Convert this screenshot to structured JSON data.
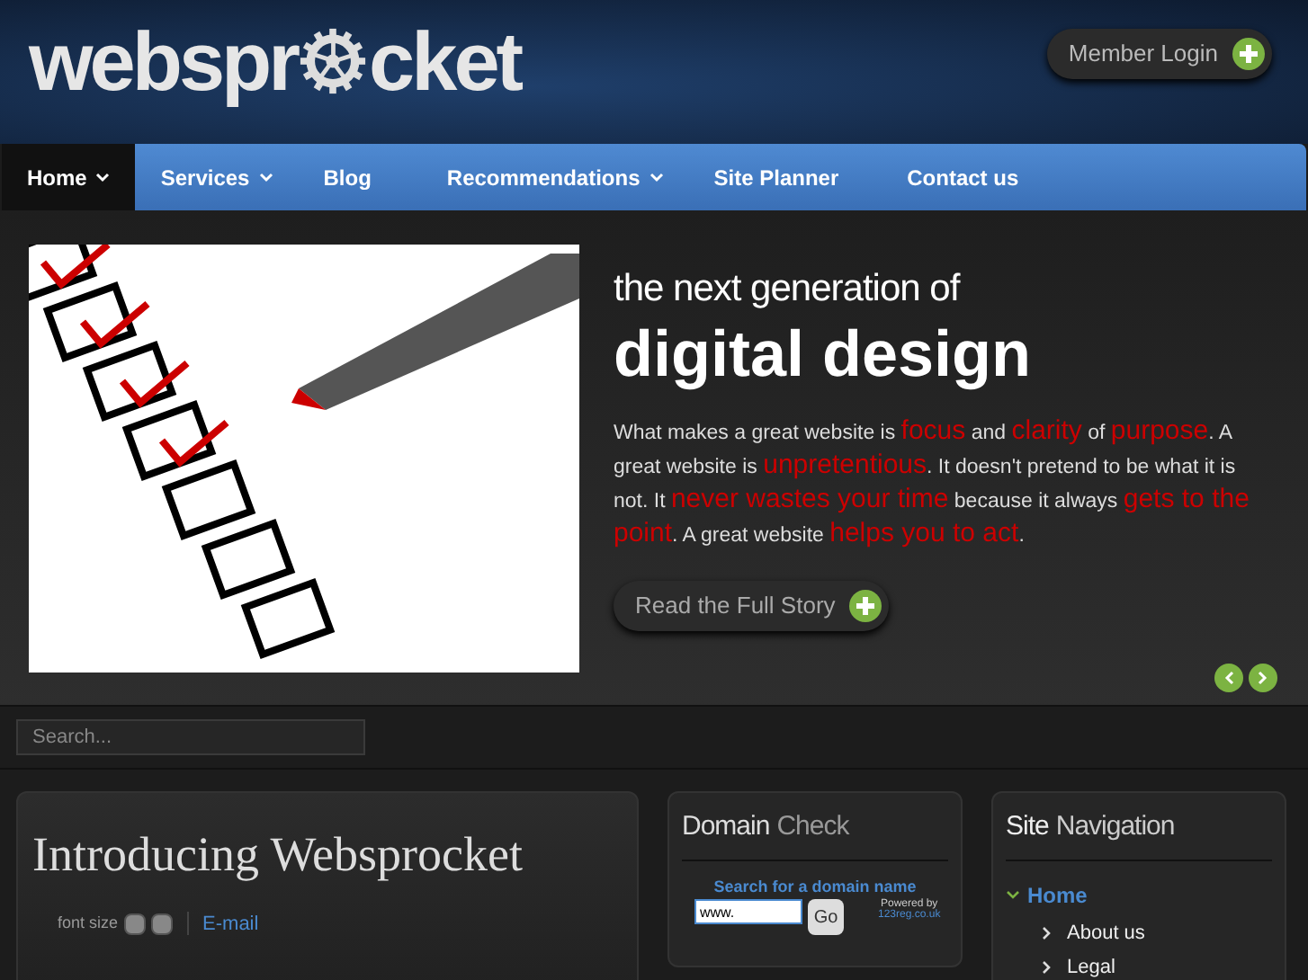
{
  "logo": {
    "before": "webspr",
    "after": "cket"
  },
  "member_login": "Member Login",
  "nav": [
    {
      "label": "Home",
      "selected": true,
      "dropdown": true
    },
    {
      "label": "Services",
      "selected": false,
      "dropdown": true
    },
    {
      "label": "Blog",
      "selected": false,
      "dropdown": false
    },
    {
      "label": "Recommendations",
      "selected": false,
      "dropdown": true
    },
    {
      "label": "Site Planner",
      "selected": false,
      "dropdown": false
    },
    {
      "label": "Contact us",
      "selected": false,
      "dropdown": false
    }
  ],
  "slide": {
    "kicker": "the next generation of",
    "headline": "digital design",
    "body": [
      {
        "text": "What makes a great website is ",
        "highlight": false
      },
      {
        "text": "focus",
        "highlight": true
      },
      {
        "text": " and ",
        "highlight": false
      },
      {
        "text": "clarity",
        "highlight": true
      },
      {
        "text": " of ",
        "highlight": false
      },
      {
        "text": "purpose",
        "highlight": true
      },
      {
        "text": ". A great website is ",
        "highlight": false
      },
      {
        "text": "unpretentious",
        "highlight": true
      },
      {
        "text": ". It doesn't pretend to be what it is not. It ",
        "highlight": false
      },
      {
        "text": "never wastes your time",
        "highlight": true
      },
      {
        "text": " because it always ",
        "highlight": false
      },
      {
        "text": "gets to the point",
        "highlight": true
      },
      {
        "text": ". A great website ",
        "highlight": false
      },
      {
        "text": "helps you to act",
        "highlight": true
      },
      {
        "text": ".",
        "highlight": false
      }
    ],
    "button": "Read the Full Story"
  },
  "search": {
    "placeholder": "Search..."
  },
  "article": {
    "title": "Introducing Websprocket",
    "font_size_label": "font size",
    "email_link": "E-mail"
  },
  "domain_check": {
    "title_main": "Domain",
    "title_accent": "Check",
    "prompt": "Search for a domain name",
    "input_value": "www.",
    "button": "Go",
    "powered_by": "Powered by",
    "powered_link": "123reg.co.uk"
  },
  "site_navigation": {
    "title_main": "Site",
    "title_accent": "Navigation",
    "items": [
      {
        "label": "Home",
        "selected": true,
        "expanded": true,
        "children": [
          {
            "label": "About us",
            "selected": false
          },
          {
            "label": "Legal",
            "selected": false
          }
        ]
      }
    ]
  }
}
